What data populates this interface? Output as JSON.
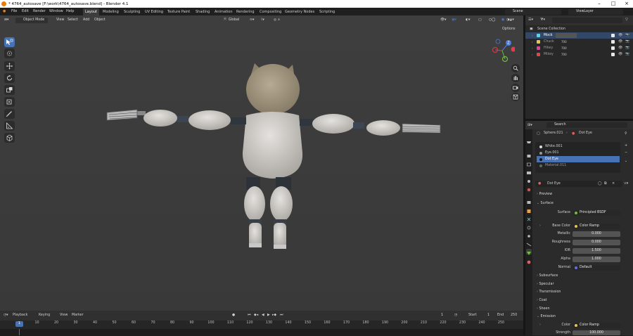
{
  "window": {
    "title": "* 4764_autosave [F:\\work\\4764_autosave.blend] - Blender 4.1"
  },
  "menu": [
    "File",
    "Edit",
    "Render",
    "Window",
    "Help"
  ],
  "workspaces": [
    "Layout",
    "Modeling",
    "Sculpting",
    "UV Editing",
    "Texture Paint",
    "Shading",
    "Animation",
    "Rendering",
    "Compositing",
    "Geometry Nodes",
    "Scripting"
  ],
  "scene": {
    "name": "Scene",
    "view_layer": "ViewLayer"
  },
  "viewport": {
    "mode": "Object Mode",
    "menus": [
      "View",
      "Select",
      "Add",
      "Object"
    ],
    "orientation": "Global",
    "options_label": "Options"
  },
  "outliner": {
    "root": "Scene Collection",
    "items": [
      {
        "name": "Mock",
        "sub": "",
        "color": "#5fd2e6"
      },
      {
        "name": "Chuck",
        "sub": "700",
        "color": "#e6c54a"
      },
      {
        "name": "Hikey",
        "sub": "700",
        "color": "#d6469c"
      },
      {
        "name": "Mikey",
        "sub": "700",
        "color": "#e04848"
      }
    ]
  },
  "properties": {
    "search_placeholder": "Search",
    "breadcrumb_object": "Sphere.021",
    "breadcrumb_material": "Dot Eye",
    "slots": [
      "White.001",
      "Eye.001",
      "Dot Eye",
      "Material.011"
    ],
    "active_slot": 2,
    "material_name": "Dot Eye",
    "sections": {
      "preview": "Preview",
      "surface": "Surface",
      "subsurface": "Subsurface",
      "specular": "Specular",
      "transmission": "Transmission",
      "coat": "Coat",
      "sheen": "Sheen",
      "emission": "Emission"
    },
    "rows": [
      {
        "label": "Surface",
        "value": "Principled BSDF",
        "kind": "node"
      },
      {
        "label": "Base Color",
        "value": "Color Ramp",
        "kind": "node"
      },
      {
        "label": "Metallic",
        "value": "0.000",
        "kind": "num"
      },
      {
        "label": "Roughness",
        "value": "0.000",
        "kind": "num"
      },
      {
        "label": "IOR",
        "value": "1.500",
        "kind": "num"
      },
      {
        "label": "Alpha",
        "value": "1.000",
        "kind": "num"
      },
      {
        "label": "Normal",
        "value": "Default",
        "kind": "node"
      }
    ],
    "emission_rows": [
      {
        "label": "Color",
        "value": "Color Ramp"
      },
      {
        "label": "Strength",
        "value": "100.000"
      }
    ]
  },
  "timeline": {
    "menus": [
      "Playback",
      "Keying",
      "View",
      "Marker"
    ],
    "current_frame": "1",
    "start_label": "Start",
    "start": "1",
    "end_label": "End",
    "end": "250",
    "ticks": [
      "10",
      "20",
      "30",
      "40",
      "50",
      "60",
      "70",
      "80",
      "90",
      "100",
      "110",
      "120",
      "130",
      "140",
      "150",
      "160",
      "170",
      "180",
      "190",
      "200",
      "210",
      "220",
      "230",
      "240",
      "250"
    ]
  },
  "colors": {
    "accent": "#4772b3",
    "axis_x": "#e33b4f",
    "axis_y": "#6ec037",
    "axis_z": "#4b7ddc"
  }
}
